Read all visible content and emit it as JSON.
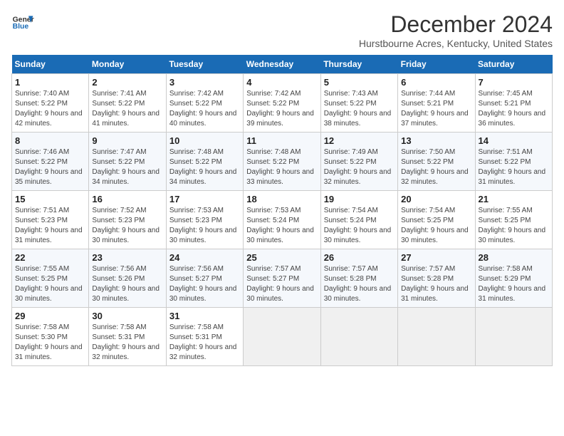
{
  "header": {
    "logo_line1": "General",
    "logo_line2": "Blue",
    "month_year": "December 2024",
    "location": "Hurstbourne Acres, Kentucky, United States"
  },
  "weekdays": [
    "Sunday",
    "Monday",
    "Tuesday",
    "Wednesday",
    "Thursday",
    "Friday",
    "Saturday"
  ],
  "weeks": [
    [
      {
        "day": "1",
        "sunrise": "7:40 AM",
        "sunset": "5:22 PM",
        "daylight": "9 hours and 42 minutes."
      },
      {
        "day": "2",
        "sunrise": "7:41 AM",
        "sunset": "5:22 PM",
        "daylight": "9 hours and 41 minutes."
      },
      {
        "day": "3",
        "sunrise": "7:42 AM",
        "sunset": "5:22 PM",
        "daylight": "9 hours and 40 minutes."
      },
      {
        "day": "4",
        "sunrise": "7:42 AM",
        "sunset": "5:22 PM",
        "daylight": "9 hours and 39 minutes."
      },
      {
        "day": "5",
        "sunrise": "7:43 AM",
        "sunset": "5:22 PM",
        "daylight": "9 hours and 38 minutes."
      },
      {
        "day": "6",
        "sunrise": "7:44 AM",
        "sunset": "5:21 PM",
        "daylight": "9 hours and 37 minutes."
      },
      {
        "day": "7",
        "sunrise": "7:45 AM",
        "sunset": "5:21 PM",
        "daylight": "9 hours and 36 minutes."
      }
    ],
    [
      {
        "day": "8",
        "sunrise": "7:46 AM",
        "sunset": "5:22 PM",
        "daylight": "9 hours and 35 minutes."
      },
      {
        "day": "9",
        "sunrise": "7:47 AM",
        "sunset": "5:22 PM",
        "daylight": "9 hours and 34 minutes."
      },
      {
        "day": "10",
        "sunrise": "7:48 AM",
        "sunset": "5:22 PM",
        "daylight": "9 hours and 34 minutes."
      },
      {
        "day": "11",
        "sunrise": "7:48 AM",
        "sunset": "5:22 PM",
        "daylight": "9 hours and 33 minutes."
      },
      {
        "day": "12",
        "sunrise": "7:49 AM",
        "sunset": "5:22 PM",
        "daylight": "9 hours and 32 minutes."
      },
      {
        "day": "13",
        "sunrise": "7:50 AM",
        "sunset": "5:22 PM",
        "daylight": "9 hours and 32 minutes."
      },
      {
        "day": "14",
        "sunrise": "7:51 AM",
        "sunset": "5:22 PM",
        "daylight": "9 hours and 31 minutes."
      }
    ],
    [
      {
        "day": "15",
        "sunrise": "7:51 AM",
        "sunset": "5:23 PM",
        "daylight": "9 hours and 31 minutes."
      },
      {
        "day": "16",
        "sunrise": "7:52 AM",
        "sunset": "5:23 PM",
        "daylight": "9 hours and 30 minutes."
      },
      {
        "day": "17",
        "sunrise": "7:53 AM",
        "sunset": "5:23 PM",
        "daylight": "9 hours and 30 minutes."
      },
      {
        "day": "18",
        "sunrise": "7:53 AM",
        "sunset": "5:24 PM",
        "daylight": "9 hours and 30 minutes."
      },
      {
        "day": "19",
        "sunrise": "7:54 AM",
        "sunset": "5:24 PM",
        "daylight": "9 hours and 30 minutes."
      },
      {
        "day": "20",
        "sunrise": "7:54 AM",
        "sunset": "5:25 PM",
        "daylight": "9 hours and 30 minutes."
      },
      {
        "day": "21",
        "sunrise": "7:55 AM",
        "sunset": "5:25 PM",
        "daylight": "9 hours and 30 minutes."
      }
    ],
    [
      {
        "day": "22",
        "sunrise": "7:55 AM",
        "sunset": "5:25 PM",
        "daylight": "9 hours and 30 minutes."
      },
      {
        "day": "23",
        "sunrise": "7:56 AM",
        "sunset": "5:26 PM",
        "daylight": "9 hours and 30 minutes."
      },
      {
        "day": "24",
        "sunrise": "7:56 AM",
        "sunset": "5:27 PM",
        "daylight": "9 hours and 30 minutes."
      },
      {
        "day": "25",
        "sunrise": "7:57 AM",
        "sunset": "5:27 PM",
        "daylight": "9 hours and 30 minutes."
      },
      {
        "day": "26",
        "sunrise": "7:57 AM",
        "sunset": "5:28 PM",
        "daylight": "9 hours and 30 minutes."
      },
      {
        "day": "27",
        "sunrise": "7:57 AM",
        "sunset": "5:28 PM",
        "daylight": "9 hours and 31 minutes."
      },
      {
        "day": "28",
        "sunrise": "7:58 AM",
        "sunset": "5:29 PM",
        "daylight": "9 hours and 31 minutes."
      }
    ],
    [
      {
        "day": "29",
        "sunrise": "7:58 AM",
        "sunset": "5:30 PM",
        "daylight": "9 hours and 31 minutes."
      },
      {
        "day": "30",
        "sunrise": "7:58 AM",
        "sunset": "5:31 PM",
        "daylight": "9 hours and 32 minutes."
      },
      {
        "day": "31",
        "sunrise": "7:58 AM",
        "sunset": "5:31 PM",
        "daylight": "9 hours and 32 minutes."
      },
      null,
      null,
      null,
      null
    ]
  ]
}
